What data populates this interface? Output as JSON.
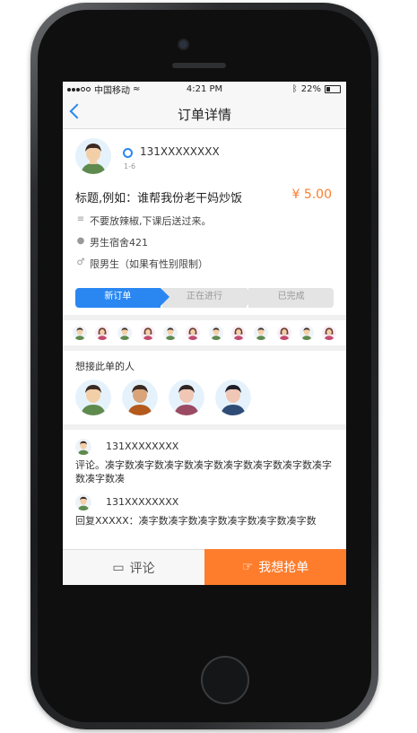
{
  "status": {
    "carrier": "中国移动",
    "time": "4:21 PM",
    "battery": "22%"
  },
  "nav": {
    "title": "订单详情"
  },
  "user": {
    "phone": "131XXXXXXXX",
    "level": "1-6"
  },
  "order": {
    "title": "标题,例如：谁帮我份老干妈炒饭",
    "price": "¥ 5.00",
    "note": "不要放辣椒,下课后送过来。",
    "address": "男生宿舍421",
    "gender_limit": "限男生（如果有性别限制）"
  },
  "steps": [
    {
      "label": "新订单"
    },
    {
      "label": "正在进行"
    },
    {
      "label": "已完成"
    }
  ],
  "wanters": {
    "heading": "想接此单的人"
  },
  "comments": [
    {
      "name": "131XXXXXXXX",
      "text": "评论。凑字数凑字数凑字数凑字数凑字数凑字数凑字数凑字数凑字数凑"
    },
    {
      "name": "131XXXXXXXX",
      "text": "回复XXXXX：凑字数凑字数凑字数凑字数凑字数凑字数"
    }
  ],
  "actions": {
    "comment": "评论",
    "grab": "我想抢单"
  },
  "colors": {
    "accent": "#2a87f2",
    "orange": "#fe7d2c"
  }
}
